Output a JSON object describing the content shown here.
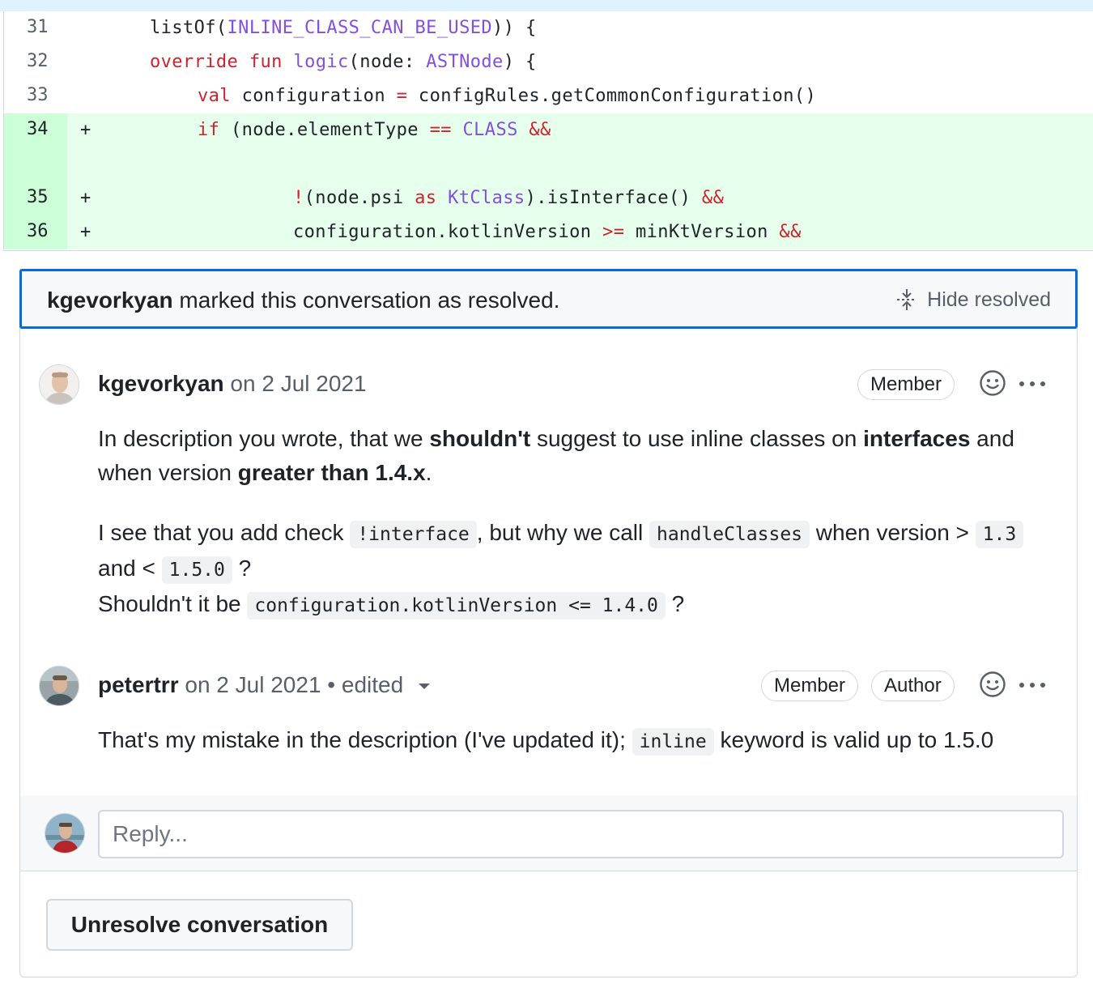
{
  "diff": {
    "lines": [
      {
        "num": "31",
        "marker": "",
        "added": false
      },
      {
        "num": "32",
        "marker": "",
        "added": false
      },
      {
        "num": "33",
        "marker": "",
        "added": false
      },
      {
        "num": "34",
        "marker": "+",
        "added": true
      },
      {
        "num": "35",
        "marker": "+",
        "added": true
      },
      {
        "num": "36",
        "marker": "+",
        "added": true
      }
    ],
    "code": {
      "l31": [
        "listOf(",
        "INLINE_CLASS_CAN_BE_USED",
        ")) {"
      ],
      "l32": [
        "override",
        " ",
        "fun",
        " ",
        "logic",
        "(node: ",
        "ASTNode",
        ") {"
      ],
      "l33": [
        "val",
        " configuration ",
        "=",
        " configRules.getCommonConfiguration()"
      ],
      "l34": [
        "if",
        " (node.elementType ",
        "==",
        " ",
        "CLASS",
        " ",
        "&&"
      ],
      "l35": [
        "!",
        "(node.psi ",
        "as",
        " ",
        "KtClass",
        ").isInterface() ",
        "&&"
      ],
      "l36": [
        "configuration.kotlinVersion ",
        ">=",
        " minKtVersion ",
        "&&"
      ]
    }
  },
  "banner": {
    "user": "kgevorkyan",
    "text": " marked this conversation as resolved.",
    "hide_label": "Hide resolved"
  },
  "comments": [
    {
      "author": "kgevorkyan",
      "meta": " on 2 Jul 2021",
      "badges": [
        "Member"
      ],
      "body": {
        "p1_a": "In description you wrote, that we ",
        "p1_b": "shouldn't",
        "p1_c": " suggest to use inline classes on ",
        "p1_d": "interfaces",
        "p1_e": " and when version ",
        "p1_f": "greater than 1.4.x",
        "p1_g": ".",
        "p2_a": "I see that you add check ",
        "p2_code1": "!interface",
        "p2_b": ", but why we call ",
        "p2_code2": "handleClasses",
        "p2_c": " when version > ",
        "p2_code3": "1.3",
        "p2_d": " and < ",
        "p2_code4": "1.5.0",
        "p2_e": " ?",
        "p3_a": "Shouldn't it be ",
        "p3_code": "configuration.kotlinVersion <= 1.4.0",
        "p3_b": " ?"
      }
    },
    {
      "author": "petertrr",
      "meta": " on 2 Jul 2021 • edited",
      "badges": [
        "Member",
        "Author"
      ],
      "body": {
        "a": "That's my mistake in the description (I've updated it); ",
        "code": "inline",
        "b": " keyword is valid up to 1.5.0"
      }
    }
  ],
  "reply": {
    "placeholder": "Reply..."
  },
  "unresolve_label": "Unresolve conversation",
  "icons": {
    "emoji": "smiley-icon",
    "more": "kebab-horizontal-icon",
    "hide": "fold-icon",
    "caret": "triangle-down-icon"
  }
}
